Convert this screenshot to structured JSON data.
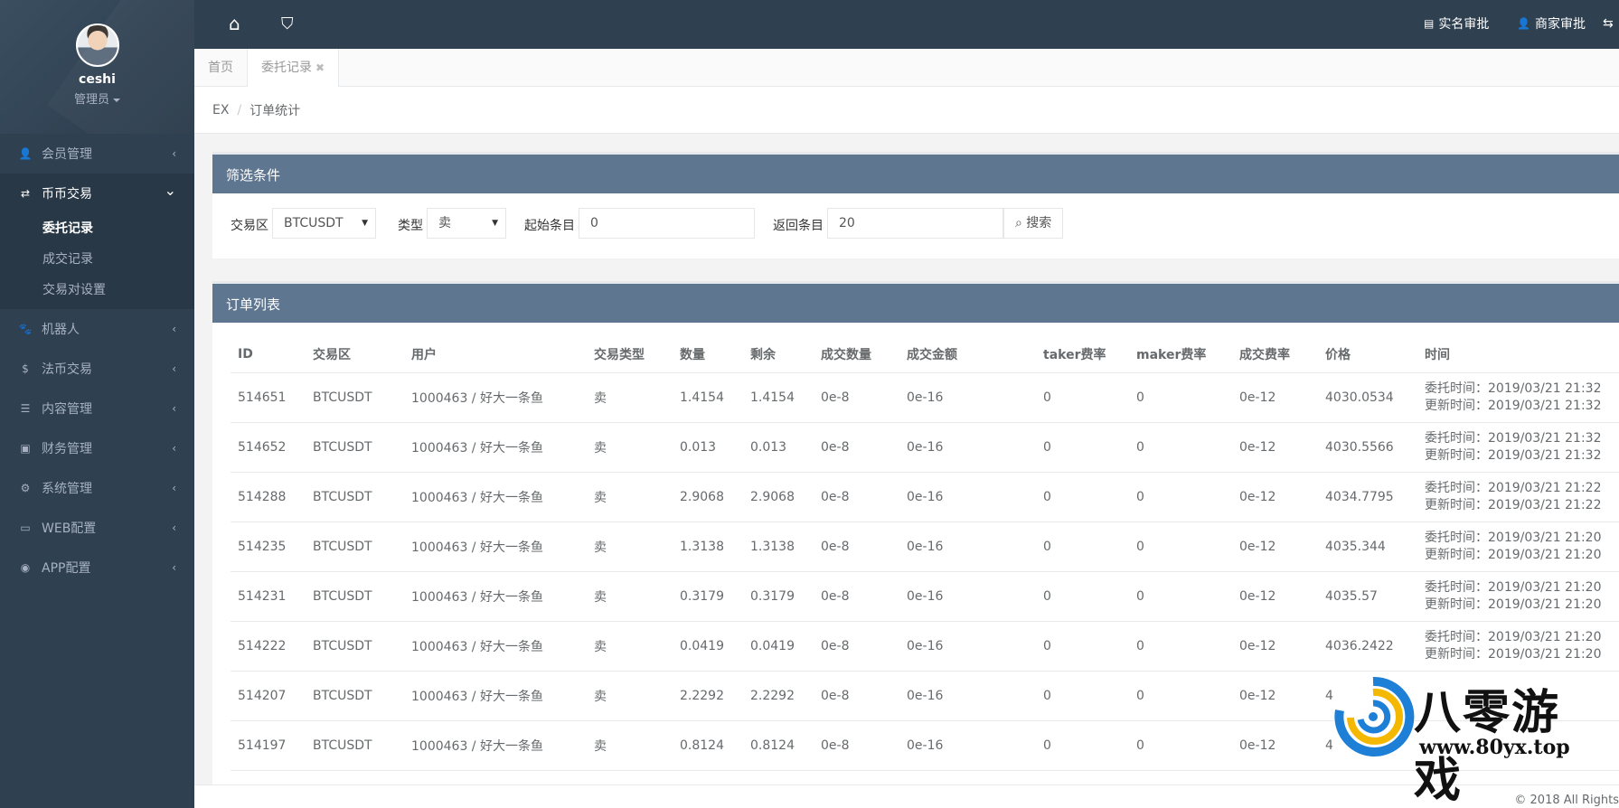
{
  "profile": {
    "name": "ceshi",
    "role": "管理员"
  },
  "sidebar": {
    "items": [
      {
        "label": "会员管理",
        "icon": "user-icon",
        "glyph": "👤"
      },
      {
        "label": "币币交易",
        "icon": "exchange-icon",
        "glyph": "⇄",
        "expanded": true,
        "children": [
          {
            "label": "委托记录",
            "active": true
          },
          {
            "label": "成交记录"
          },
          {
            "label": "交易对设置"
          }
        ]
      },
      {
        "label": "机器人",
        "icon": "paw-icon",
        "glyph": "🐾"
      },
      {
        "label": "法币交易",
        "icon": "dollar-icon",
        "glyph": "$"
      },
      {
        "label": "内容管理",
        "icon": "list-icon",
        "glyph": "☰"
      },
      {
        "label": "财务管理",
        "icon": "money-icon",
        "glyph": "▣"
      },
      {
        "label": "系统管理",
        "icon": "gears-icon",
        "glyph": "⚙"
      },
      {
        "label": "WEB配置",
        "icon": "laptop-icon",
        "glyph": "▭"
      },
      {
        "label": "APP配置",
        "icon": "android-icon",
        "glyph": "◉"
      }
    ]
  },
  "topbar": {
    "realname_label": "实名审批",
    "merchant_label": "商家审批"
  },
  "tabs": {
    "home": "首页",
    "orders": "委托记录"
  },
  "breadcrumb": {
    "root": "EX",
    "current": "订单统计"
  },
  "filter": {
    "title": "筛选条件",
    "market_label": "交易区",
    "market_value": "BTCUSDT",
    "type_label": "类型",
    "type_value": "卖",
    "start_label": "起始条目",
    "start_value": "0",
    "limit_label": "返回条目",
    "limit_value": "20",
    "search_label": "搜索"
  },
  "orders": {
    "title": "订单列表",
    "columns": [
      "ID",
      "交易区",
      "用户",
      "交易类型",
      "数量",
      "剩余",
      "成交数量",
      "成交金额",
      "taker费率",
      "maker费率",
      "成交费率",
      "价格",
      "时间"
    ],
    "rows": [
      [
        "514651",
        "BTCUSDT",
        "1000463 / 好大一条鱼",
        "卖",
        "1.4154",
        "1.4154",
        "0e-8",
        "0e-16",
        "0",
        "0",
        "0e-12",
        "4030.0534",
        "委托时间：2019/03/21 21:32",
        "更新时间：2019/03/21 21:32"
      ],
      [
        "514652",
        "BTCUSDT",
        "1000463 / 好大一条鱼",
        "卖",
        "0.013",
        "0.013",
        "0e-8",
        "0e-16",
        "0",
        "0",
        "0e-12",
        "4030.5566",
        "委托时间：2019/03/21 21:32",
        "更新时间：2019/03/21 21:32"
      ],
      [
        "514288",
        "BTCUSDT",
        "1000463 / 好大一条鱼",
        "卖",
        "2.9068",
        "2.9068",
        "0e-8",
        "0e-16",
        "0",
        "0",
        "0e-12",
        "4034.7795",
        "委托时间：2019/03/21 21:22",
        "更新时间：2019/03/21 21:22"
      ],
      [
        "514235",
        "BTCUSDT",
        "1000463 / 好大一条鱼",
        "卖",
        "1.3138",
        "1.3138",
        "0e-8",
        "0e-16",
        "0",
        "0",
        "0e-12",
        "4035.344",
        "委托时间：2019/03/21 21:20",
        "更新时间：2019/03/21 21:20"
      ],
      [
        "514231",
        "BTCUSDT",
        "1000463 / 好大一条鱼",
        "卖",
        "0.3179",
        "0.3179",
        "0e-8",
        "0e-16",
        "0",
        "0",
        "0e-12",
        "4035.57",
        "委托时间：2019/03/21 21:20",
        "更新时间：2019/03/21 21:20"
      ],
      [
        "514222",
        "BTCUSDT",
        "1000463 / 好大一条鱼",
        "卖",
        "0.0419",
        "0.0419",
        "0e-8",
        "0e-16",
        "0",
        "0",
        "0e-12",
        "4036.2422",
        "委托时间：2019/03/21 21:20",
        "更新时间：2019/03/21 21:20"
      ],
      [
        "514207",
        "BTCUSDT",
        "1000463 / 好大一条鱼",
        "卖",
        "2.2292",
        "2.2292",
        "0e-8",
        "0e-16",
        "0",
        "0",
        "0e-12",
        "4",
        "",
        ""
      ],
      [
        "514197",
        "BTCUSDT",
        "1000463 / 好大一条鱼",
        "卖",
        "0.8124",
        "0.8124",
        "0e-8",
        "0e-16",
        "0",
        "0",
        "0e-12",
        "4",
        "",
        ""
      ]
    ]
  },
  "footer": {
    "copyright": "© 2018 All Rights"
  },
  "watermark": {
    "title": "八零游戏",
    "url": "www.80yx.top"
  }
}
